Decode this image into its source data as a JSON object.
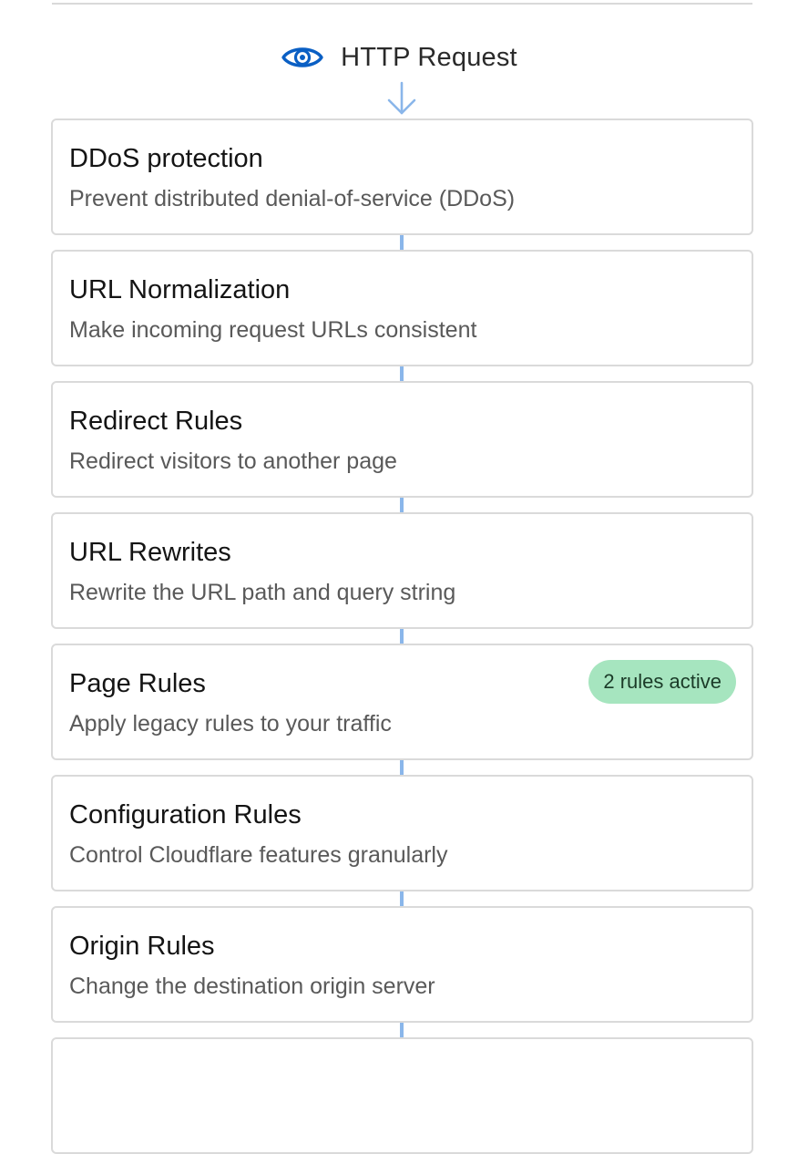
{
  "header": {
    "title": "HTTP Request",
    "icon": "eye-icon",
    "arrow_icon": "arrow-down-icon",
    "accent_color": "#0a5fc4",
    "arrow_color": "#8ab6ea"
  },
  "steps": [
    {
      "title": "DDoS protection",
      "description": "Prevent distributed denial-of-service (DDoS)"
    },
    {
      "title": "URL Normalization",
      "description": "Make incoming request URLs consistent"
    },
    {
      "title": "Redirect Rules",
      "description": "Redirect visitors to another page"
    },
    {
      "title": "URL Rewrites",
      "description": "Rewrite the URL path and query string"
    },
    {
      "title": "Page Rules",
      "description": "Apply legacy rules to your traffic",
      "badge": "2 rules active",
      "badge_color": "#a6e5bf"
    },
    {
      "title": "Configuration Rules",
      "description": "Control Cloudflare features granularly"
    },
    {
      "title": "Origin Rules",
      "description": "Change the destination origin server"
    },
    {
      "title": "",
      "description": ""
    }
  ]
}
